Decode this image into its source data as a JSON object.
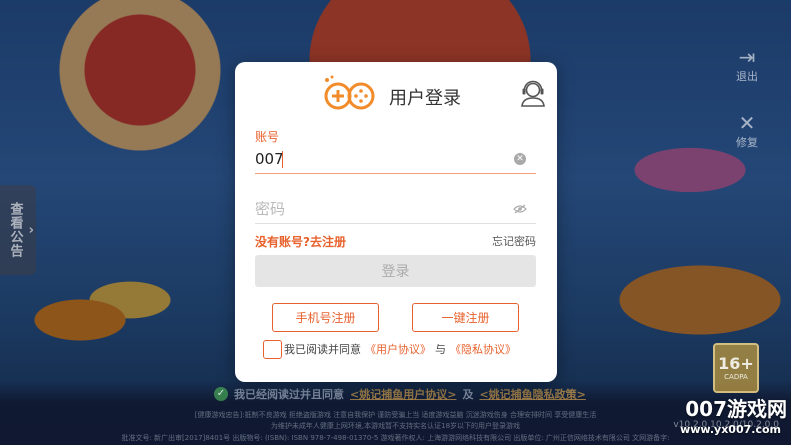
{
  "background": {
    "notice_tab_label": "查看公告",
    "notice_tab_arrow": "›",
    "exit_label": "退出",
    "exit_glyph": "⇥",
    "repair_label": "修复",
    "repair_glyph": "✕",
    "age_rating": "16+",
    "age_rating_org": "CADPA",
    "bottom_agree_text": "我已经阅读过并且同意",
    "bottom_agree_link1": "<姚记捕鱼用户协议>",
    "bottom_agree_and": "及",
    "bottom_agree_link2": "<姚记捕鱼隐私政策>",
    "legal_line1": "[健康游戏忠告]:抵制不良游戏 拒绝盗版游戏 注意自我保护 谨防受骗上当 适度游戏益脑 沉迷游戏伤身 合理安排时间 享受健康生活",
    "legal_line2": "为维护未成年人健康上网环境,本游戏暂不支持实名认证18岁以下的用户登录游戏",
    "legal_line3": "批准文号: 新广出审[2017]8401号 出版物号: (ISBN): ISBN 978-7-498-01370-5 游戏著作权人: 上海游游网络科技有限公司 出版单位: 广州正信网络技术有限公司 文网游备字:",
    "version": "v10.2.0.10.2.0/10.2.0.0",
    "watermark": "007游戏网",
    "watermark_url": "www.yx007.com"
  },
  "dialog": {
    "title": "用户登录",
    "logo_icon": "gamepad-logo-icon",
    "support_icon": "customer-service-icon",
    "account_label": "账号",
    "account_value": "007",
    "clear_glyph": "✕",
    "password_placeholder": "密码",
    "register_link": "没有账号?去注册",
    "forgot_link": "忘记密码",
    "login_button": "登录",
    "phone_register_button": "手机号注册",
    "quick_register_button": "一键注册",
    "agree_text": "我已阅读并同意",
    "user_agreement": "《用户协议》",
    "agree_and": "与",
    "privacy_agreement": "《隐私协议》"
  },
  "colors": {
    "accent": "#e8622e",
    "logo_orange": "#f28c2a",
    "login_disabled_bg": "#e5e5e5",
    "dialog_bg": "#ffffff"
  }
}
